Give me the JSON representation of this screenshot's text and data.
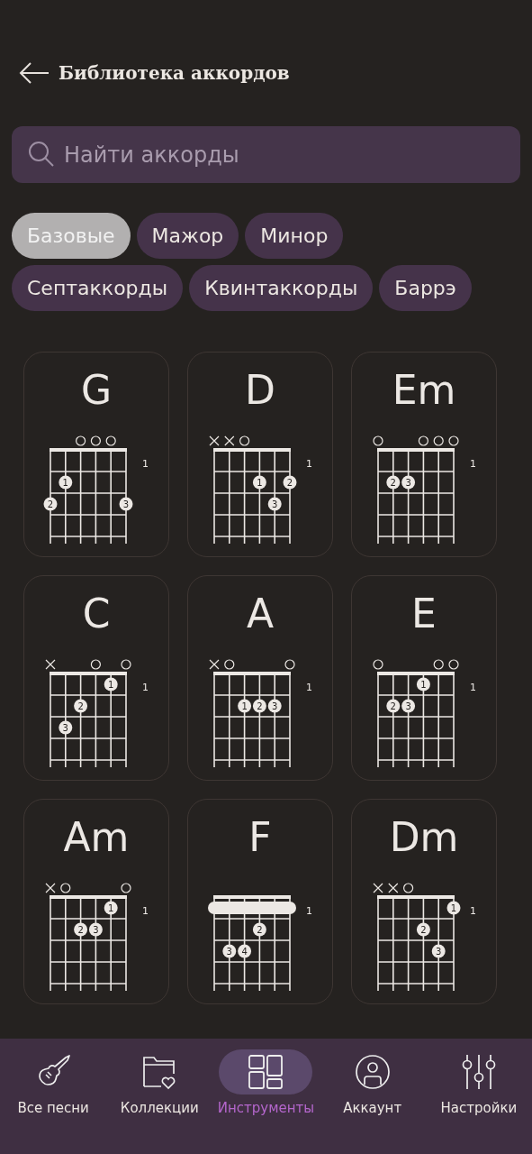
{
  "header": {
    "title": "Библиотека аккордов"
  },
  "search": {
    "placeholder": "Найти аккорды"
  },
  "filters": [
    {
      "label": "Базовые",
      "selected": true
    },
    {
      "label": "Мажор",
      "selected": false
    },
    {
      "label": "Минор",
      "selected": false
    },
    {
      "label": "Септаккорды",
      "selected": false
    },
    {
      "label": "Квинтаккорды",
      "selected": false
    },
    {
      "label": "Баррэ",
      "selected": false
    }
  ],
  "chords": [
    {
      "name": "G",
      "start_fret": "1",
      "markers": [
        {
          "kind": "none"
        },
        {
          "kind": "none"
        },
        {
          "kind": "open"
        },
        {
          "kind": "open"
        },
        {
          "kind": "open"
        },
        {
          "kind": "none"
        }
      ],
      "frets": [
        {
          "kind": "plain"
        },
        {
          "kind": "dots",
          "cells": [
            {
              "kind": "none"
            },
            {
              "kind": "dot",
              "finger": "1"
            },
            {
              "kind": "none"
            },
            {
              "kind": "none"
            },
            {
              "kind": "none"
            },
            {
              "kind": "none"
            }
          ]
        },
        {
          "kind": "dots",
          "cells": [
            {
              "kind": "dot",
              "finger": "2"
            },
            {
              "kind": "none"
            },
            {
              "kind": "none"
            },
            {
              "kind": "none"
            },
            {
              "kind": "none"
            },
            {
              "kind": "dot",
              "finger": "3"
            }
          ]
        }
      ]
    },
    {
      "name": "D",
      "start_fret": "1",
      "markers": [
        {
          "kind": "muted"
        },
        {
          "kind": "muted"
        },
        {
          "kind": "open"
        },
        {
          "kind": "none"
        },
        {
          "kind": "none"
        },
        {
          "kind": "none"
        }
      ],
      "frets": [
        {
          "kind": "plain"
        },
        {
          "kind": "dots",
          "cells": [
            {
              "kind": "none"
            },
            {
              "kind": "none"
            },
            {
              "kind": "none"
            },
            {
              "kind": "dot",
              "finger": "1"
            },
            {
              "kind": "none"
            },
            {
              "kind": "dot",
              "finger": "2"
            }
          ]
        },
        {
          "kind": "dots",
          "cells": [
            {
              "kind": "none"
            },
            {
              "kind": "none"
            },
            {
              "kind": "none"
            },
            {
              "kind": "none"
            },
            {
              "kind": "dot",
              "finger": "3"
            },
            {
              "kind": "none"
            }
          ]
        }
      ]
    },
    {
      "name": "Em",
      "start_fret": "1",
      "markers": [
        {
          "kind": "open"
        },
        {
          "kind": "none"
        },
        {
          "kind": "none"
        },
        {
          "kind": "open"
        },
        {
          "kind": "open"
        },
        {
          "kind": "open"
        }
      ],
      "frets": [
        {
          "kind": "plain"
        },
        {
          "kind": "dots",
          "cells": [
            {
              "kind": "none"
            },
            {
              "kind": "dot",
              "finger": "2"
            },
            {
              "kind": "dot",
              "finger": "3"
            },
            {
              "kind": "none"
            },
            {
              "kind": "none"
            },
            {
              "kind": "none"
            }
          ]
        },
        {
          "kind": "plain"
        }
      ]
    },
    {
      "name": "C",
      "start_fret": "1",
      "markers": [
        {
          "kind": "muted"
        },
        {
          "kind": "none"
        },
        {
          "kind": "none"
        },
        {
          "kind": "open"
        },
        {
          "kind": "none"
        },
        {
          "kind": "open"
        }
      ],
      "frets": [
        {
          "kind": "dots",
          "cells": [
            {
              "kind": "none"
            },
            {
              "kind": "none"
            },
            {
              "kind": "none"
            },
            {
              "kind": "none"
            },
            {
              "kind": "dot",
              "finger": "1"
            },
            {
              "kind": "none"
            }
          ]
        },
        {
          "kind": "dots",
          "cells": [
            {
              "kind": "none"
            },
            {
              "kind": "none"
            },
            {
              "kind": "dot",
              "finger": "2"
            },
            {
              "kind": "none"
            },
            {
              "kind": "none"
            },
            {
              "kind": "none"
            }
          ]
        },
        {
          "kind": "dots",
          "cells": [
            {
              "kind": "none"
            },
            {
              "kind": "dot",
              "finger": "3"
            },
            {
              "kind": "none"
            },
            {
              "kind": "none"
            },
            {
              "kind": "none"
            },
            {
              "kind": "none"
            }
          ]
        }
      ]
    },
    {
      "name": "A",
      "start_fret": "1",
      "markers": [
        {
          "kind": "muted"
        },
        {
          "kind": "open"
        },
        {
          "kind": "none"
        },
        {
          "kind": "none"
        },
        {
          "kind": "none"
        },
        {
          "kind": "open"
        }
      ],
      "frets": [
        {
          "kind": "plain"
        },
        {
          "kind": "dots",
          "cells": [
            {
              "kind": "none"
            },
            {
              "kind": "none"
            },
            {
              "kind": "dot",
              "finger": "1"
            },
            {
              "kind": "dot",
              "finger": "2"
            },
            {
              "kind": "dot",
              "finger": "3"
            },
            {
              "kind": "none"
            }
          ]
        },
        {
          "kind": "plain"
        }
      ]
    },
    {
      "name": "E",
      "start_fret": "1",
      "markers": [
        {
          "kind": "open"
        },
        {
          "kind": "none"
        },
        {
          "kind": "none"
        },
        {
          "kind": "none"
        },
        {
          "kind": "open"
        },
        {
          "kind": "open"
        }
      ],
      "frets": [
        {
          "kind": "dots",
          "cells": [
            {
              "kind": "none"
            },
            {
              "kind": "none"
            },
            {
              "kind": "none"
            },
            {
              "kind": "dot",
              "finger": "1"
            },
            {
              "kind": "none"
            },
            {
              "kind": "none"
            }
          ]
        },
        {
          "kind": "dots",
          "cells": [
            {
              "kind": "none"
            },
            {
              "kind": "dot",
              "finger": "2"
            },
            {
              "kind": "dot",
              "finger": "3"
            },
            {
              "kind": "none"
            },
            {
              "kind": "none"
            },
            {
              "kind": "none"
            }
          ]
        },
        {
          "kind": "plain"
        }
      ]
    },
    {
      "name": "Am",
      "start_fret": "1",
      "markers": [
        {
          "kind": "muted"
        },
        {
          "kind": "open"
        },
        {
          "kind": "none"
        },
        {
          "kind": "none"
        },
        {
          "kind": "none"
        },
        {
          "kind": "open"
        }
      ],
      "frets": [
        {
          "kind": "dots",
          "cells": [
            {
              "kind": "none"
            },
            {
              "kind": "none"
            },
            {
              "kind": "none"
            },
            {
              "kind": "none"
            },
            {
              "kind": "dot",
              "finger": "1"
            },
            {
              "kind": "none"
            }
          ]
        },
        {
          "kind": "dots",
          "cells": [
            {
              "kind": "none"
            },
            {
              "kind": "none"
            },
            {
              "kind": "dot",
              "finger": "2"
            },
            {
              "kind": "dot",
              "finger": "3"
            },
            {
              "kind": "none"
            },
            {
              "kind": "none"
            }
          ]
        },
        {
          "kind": "plain"
        }
      ]
    },
    {
      "name": "F",
      "start_fret": "1",
      "markers": [
        {
          "kind": "none"
        },
        {
          "kind": "none"
        },
        {
          "kind": "none"
        },
        {
          "kind": "none"
        },
        {
          "kind": "none"
        },
        {
          "kind": "none"
        }
      ],
      "frets": [
        {
          "kind": "barre"
        },
        {
          "kind": "dots",
          "cells": [
            {
              "kind": "none"
            },
            {
              "kind": "none"
            },
            {
              "kind": "none"
            },
            {
              "kind": "dot",
              "finger": "2"
            },
            {
              "kind": "none"
            },
            {
              "kind": "none"
            }
          ]
        },
        {
          "kind": "dots",
          "cells": [
            {
              "kind": "none"
            },
            {
              "kind": "dot",
              "finger": "3"
            },
            {
              "kind": "dot",
              "finger": "4"
            },
            {
              "kind": "none"
            },
            {
              "kind": "none"
            },
            {
              "kind": "none"
            }
          ]
        }
      ]
    },
    {
      "name": "Dm",
      "start_fret": "1",
      "markers": [
        {
          "kind": "muted"
        },
        {
          "kind": "muted"
        },
        {
          "kind": "open"
        },
        {
          "kind": "none"
        },
        {
          "kind": "none"
        },
        {
          "kind": "none"
        }
      ],
      "frets": [
        {
          "kind": "dots",
          "cells": [
            {
              "kind": "none"
            },
            {
              "kind": "none"
            },
            {
              "kind": "none"
            },
            {
              "kind": "none"
            },
            {
              "kind": "none"
            },
            {
              "kind": "dot",
              "finger": "1"
            }
          ]
        },
        {
          "kind": "dots",
          "cells": [
            {
              "kind": "none"
            },
            {
              "kind": "none"
            },
            {
              "kind": "none"
            },
            {
              "kind": "dot",
              "finger": "2"
            },
            {
              "kind": "none"
            },
            {
              "kind": "none"
            }
          ]
        },
        {
          "kind": "dots",
          "cells": [
            {
              "kind": "none"
            },
            {
              "kind": "none"
            },
            {
              "kind": "none"
            },
            {
              "kind": "none"
            },
            {
              "kind": "dot",
              "finger": "3"
            },
            {
              "kind": "none"
            }
          ]
        }
      ]
    }
  ],
  "nav": [
    {
      "label": "Все песни",
      "selected": false
    },
    {
      "label": "Коллекции",
      "selected": false
    },
    {
      "label": "Инструменты",
      "selected": true
    },
    {
      "label": "Аккаунт",
      "selected": false
    },
    {
      "label": "Настройки",
      "selected": false
    }
  ]
}
